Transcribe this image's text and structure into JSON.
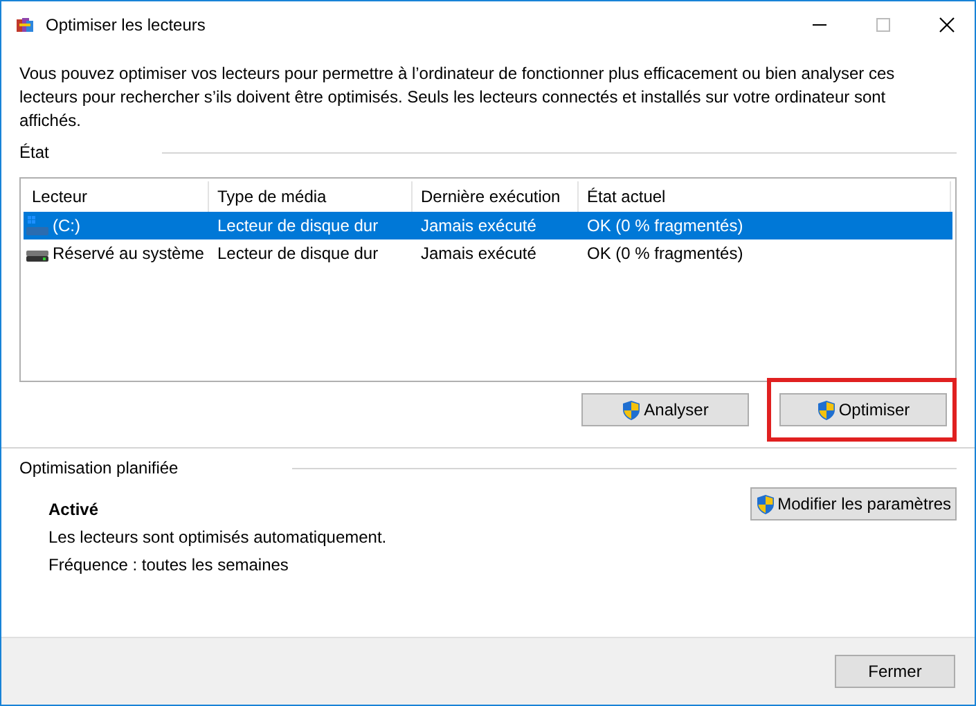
{
  "window": {
    "title": "Optimiser les lecteurs"
  },
  "description": "Vous pouvez optimiser vos lecteurs pour permettre à l’ordinateur de fonctionner plus efficacement ou bien analyser ces lecteurs pour rechercher s’ils doivent être optimisés. Seuls les lecteurs connectés et installés sur votre ordinateur sont affichés.",
  "status_section": {
    "title": "État"
  },
  "table": {
    "columns": [
      "Lecteur",
      "Type de média",
      "Dernière exécution",
      "État actuel"
    ],
    "rows": [
      {
        "kind": "system",
        "selected": true,
        "cells": [
          "(C:)",
          "Lecteur de disque dur",
          "Jamais exécuté",
          "OK (0 % fragmentés)"
        ]
      },
      {
        "kind": "plain",
        "selected": false,
        "cells": [
          "Réservé au système",
          "Lecteur de disque dur",
          "Jamais exécuté",
          "OK (0 % fragmentés)"
        ]
      }
    ]
  },
  "actions": [
    {
      "label": "Analyser",
      "highlighted": false
    },
    {
      "label": "Optimiser",
      "highlighted": true
    }
  ],
  "schedule": {
    "title": "Optimisation planifiée",
    "state": "Activé",
    "lines": [
      "Les lecteurs sont optimisés automatiquement.",
      "Fréquence : toutes les semaines"
    ],
    "button": "Modifier les paramètres"
  },
  "footer": {
    "button": "Fermer"
  }
}
